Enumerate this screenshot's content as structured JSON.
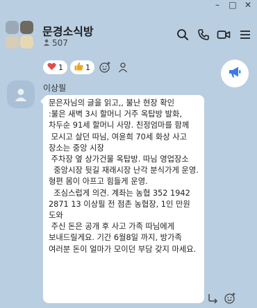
{
  "window": {
    "controls": {
      "minimize": "–",
      "maximize": "□",
      "close": "✕"
    }
  },
  "header": {
    "title": "문경소식방",
    "member_count": "507",
    "avatar_colors": [
      "#9aa8b8",
      "#6e6a62",
      "#d8cdb8",
      "#e7d8b4"
    ],
    "icons": [
      "search-icon",
      "phone-icon",
      "video-call-icon",
      "menu-icon"
    ]
  },
  "reactions": {
    "items": [
      {
        "emoji": "❤",
        "count": "1",
        "color": "#e24c4c"
      },
      {
        "emoji": "👍",
        "count": "1",
        "color": "#f1a420"
      }
    ],
    "add_icon": "add-reaction-icon",
    "profile_icon": "profile-icon"
  },
  "notice": {
    "icon": "megaphone-icon",
    "color": "#3c7be0"
  },
  "message": {
    "sender": "이상필",
    "text": "문은자님의 글을 읽고,, 불난 현장 확인\n:불은 새벽 3시 할머니 거주 옥탑방 발화, 차두순 91세 할머니 사망. 친정엄마를 함께\n 모시고 살던 따님, 여윤희 70세 화상 사고 장소는 중앙 시장\n 주차장 옆 상가건물 옥탑방. 따님 영업장소\n  중앙시장 뒷길 재래시장 난각 분식가게 운영. 형편 몸이 아프고 힘들게 운영.\n  조심스럽게 의견. 계좌는 농협 352 1942 2871 13 이상필 전 점촌 농협장, 1인 만원 도와\n 주신 돈은 공개 후 사고 가족 따님에게 보내드릴게요. 기간 6월8일 까지, 방가족 여러분 돈이 얼마가 모이던 부담 갖지 마세요.",
    "actions": [
      "reply-icon",
      "add-reaction-icon"
    ]
  }
}
